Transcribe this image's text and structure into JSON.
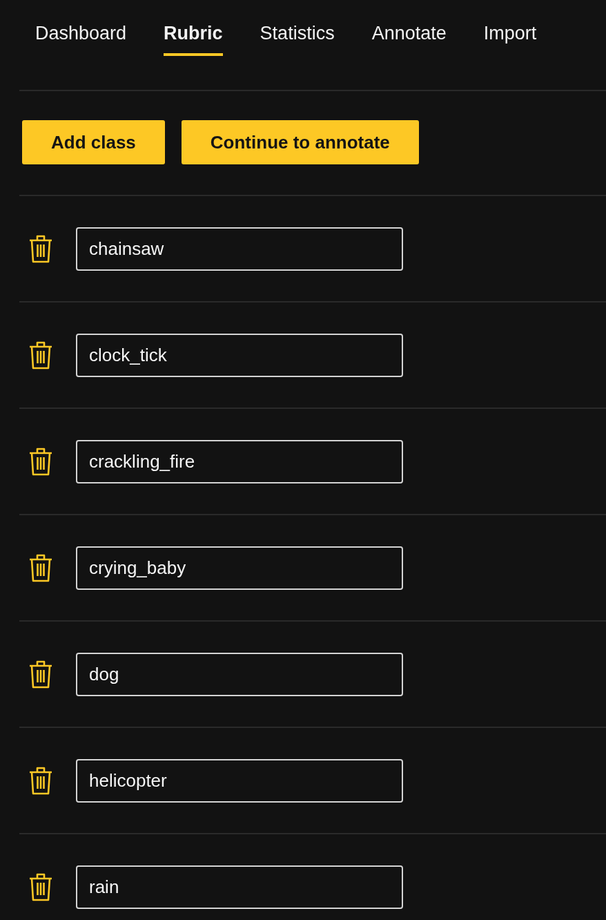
{
  "tabs": [
    {
      "label": "Dashboard",
      "selected": false
    },
    {
      "label": "Rubric",
      "selected": true
    },
    {
      "label": "Statistics",
      "selected": false
    },
    {
      "label": "Annotate",
      "selected": false
    },
    {
      "label": "Import",
      "selected": false
    }
  ],
  "buttons": [
    "Add class",
    "Continue to annotate"
  ],
  "classes": [
    {
      "value": "chainsaw"
    },
    {
      "value": "clock_tick"
    },
    {
      "value": "crackling_fire"
    },
    {
      "value": "crying_baby"
    },
    {
      "value": "dog"
    },
    {
      "value": "helicopter"
    },
    {
      "value": "rain"
    }
  ]
}
